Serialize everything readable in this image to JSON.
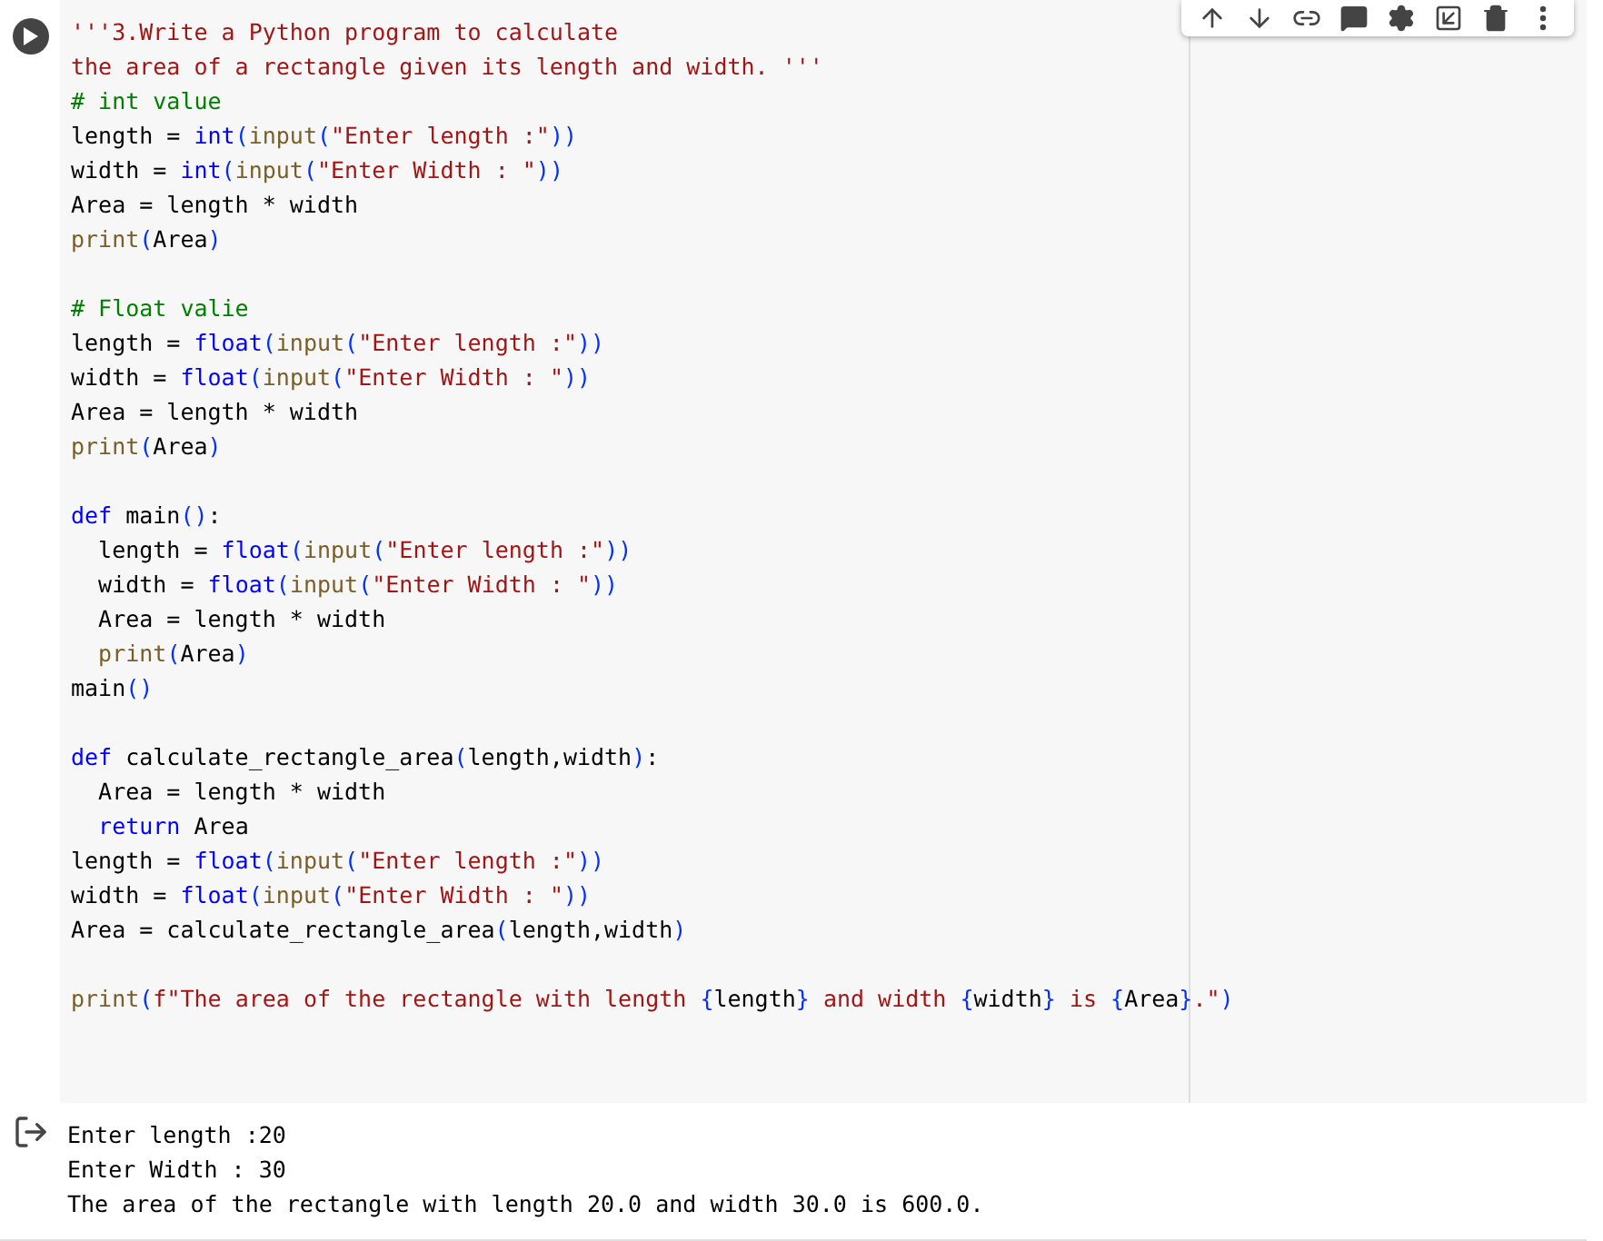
{
  "toolbar": {
    "buttons": [
      {
        "kind": "up"
      },
      {
        "kind": "down"
      },
      {
        "kind": "link"
      },
      {
        "kind": "comment"
      },
      {
        "kind": "settings"
      },
      {
        "kind": "mirror"
      },
      {
        "kind": "delete"
      },
      {
        "kind": "more"
      }
    ]
  },
  "code_blocks": [
    {
      "lines": [
        [
          {
            "kind": "str",
            "text": "'''3.Write a Python program to calculate"
          }
        ],
        [
          {
            "kind": "str",
            "text": "the area of a rectangle given its length and width. '''"
          }
        ],
        [
          {
            "kind": "comment",
            "text": "# int value"
          }
        ],
        [
          {
            "kind": "plain",
            "text": "length = "
          },
          {
            "kind": "kw",
            "text": "int"
          },
          {
            "kind": "paren",
            "text": "("
          },
          {
            "kind": "fn",
            "text": "input"
          },
          {
            "kind": "paren",
            "text": "("
          },
          {
            "kind": "str",
            "text": "\"Enter length :\""
          },
          {
            "kind": "paren",
            "text": "))"
          }
        ],
        [
          {
            "kind": "plain",
            "text": "width = "
          },
          {
            "kind": "kw",
            "text": "int"
          },
          {
            "kind": "paren",
            "text": "("
          },
          {
            "kind": "fn",
            "text": "input"
          },
          {
            "kind": "paren",
            "text": "("
          },
          {
            "kind": "str",
            "text": "\"Enter Width : \""
          },
          {
            "kind": "paren",
            "text": "))"
          }
        ],
        [
          {
            "kind": "plain",
            "text": "Area = length * width"
          }
        ],
        [
          {
            "kind": "fn",
            "text": "print"
          },
          {
            "kind": "paren",
            "text": "("
          },
          {
            "kind": "plain",
            "text": "Area"
          },
          {
            "kind": "paren",
            "text": ")"
          }
        ]
      ]
    },
    {
      "lines": [
        [
          {
            "kind": "comment",
            "text": "# Float valie"
          }
        ],
        [
          {
            "kind": "plain",
            "text": "length = "
          },
          {
            "kind": "kw",
            "text": "float"
          },
          {
            "kind": "paren",
            "text": "("
          },
          {
            "kind": "fn",
            "text": "input"
          },
          {
            "kind": "paren",
            "text": "("
          },
          {
            "kind": "str",
            "text": "\"Enter length :\""
          },
          {
            "kind": "paren",
            "text": "))"
          }
        ],
        [
          {
            "kind": "plain",
            "text": "width = "
          },
          {
            "kind": "kw",
            "text": "float"
          },
          {
            "kind": "paren",
            "text": "("
          },
          {
            "kind": "fn",
            "text": "input"
          },
          {
            "kind": "paren",
            "text": "("
          },
          {
            "kind": "str",
            "text": "\"Enter Width : \""
          },
          {
            "kind": "paren",
            "text": "))"
          }
        ],
        [
          {
            "kind": "plain",
            "text": "Area = length * width"
          }
        ],
        [
          {
            "kind": "fn",
            "text": "print"
          },
          {
            "kind": "paren",
            "text": "("
          },
          {
            "kind": "plain",
            "text": "Area"
          },
          {
            "kind": "paren",
            "text": ")"
          }
        ]
      ]
    },
    {
      "lines": [
        [
          {
            "kind": "kw",
            "text": "def"
          },
          {
            "kind": "plain",
            "text": " main"
          },
          {
            "kind": "paren",
            "text": "()"
          },
          {
            "kind": "plain",
            "text": ":"
          }
        ],
        [
          {
            "kind": "plain",
            "text": "  length = "
          },
          {
            "kind": "kw",
            "text": "float"
          },
          {
            "kind": "paren",
            "text": "("
          },
          {
            "kind": "fn",
            "text": "input"
          },
          {
            "kind": "paren",
            "text": "("
          },
          {
            "kind": "str",
            "text": "\"Enter length :\""
          },
          {
            "kind": "paren",
            "text": "))"
          }
        ],
        [
          {
            "kind": "plain",
            "text": "  width = "
          },
          {
            "kind": "kw",
            "text": "float"
          },
          {
            "kind": "paren",
            "text": "("
          },
          {
            "kind": "fn",
            "text": "input"
          },
          {
            "kind": "paren",
            "text": "("
          },
          {
            "kind": "str",
            "text": "\"Enter Width : \""
          },
          {
            "kind": "paren",
            "text": "))"
          }
        ],
        [
          {
            "kind": "plain",
            "text": "  Area = length * width"
          }
        ],
        [
          {
            "kind": "fn",
            "text": "  print"
          },
          {
            "kind": "paren",
            "text": "("
          },
          {
            "kind": "plain",
            "text": "Area"
          },
          {
            "kind": "paren",
            "text": ")"
          }
        ],
        [
          {
            "kind": "plain",
            "text": "main"
          },
          {
            "kind": "paren",
            "text": "()"
          }
        ]
      ]
    },
    {
      "lines": [
        [
          {
            "kind": "kw",
            "text": "def"
          },
          {
            "kind": "plain",
            "text": " calculate_rectangle_area"
          },
          {
            "kind": "paren",
            "text": "("
          },
          {
            "kind": "plain",
            "text": "length,width"
          },
          {
            "kind": "paren",
            "text": ")"
          },
          {
            "kind": "plain",
            "text": ":"
          }
        ],
        [
          {
            "kind": "plain",
            "text": "  Area = length * width"
          }
        ],
        [
          {
            "kind": "kw",
            "text": "  return"
          },
          {
            "kind": "plain",
            "text": " Area"
          }
        ],
        [
          {
            "kind": "plain",
            "text": "length = "
          },
          {
            "kind": "kw",
            "text": "float"
          },
          {
            "kind": "paren",
            "text": "("
          },
          {
            "kind": "fn",
            "text": "input"
          },
          {
            "kind": "paren",
            "text": "("
          },
          {
            "kind": "str",
            "text": "\"Enter length :\""
          },
          {
            "kind": "paren",
            "text": "))"
          }
        ],
        [
          {
            "kind": "plain",
            "text": "width = "
          },
          {
            "kind": "kw",
            "text": "float"
          },
          {
            "kind": "paren",
            "text": "("
          },
          {
            "kind": "fn",
            "text": "input"
          },
          {
            "kind": "paren",
            "text": "("
          },
          {
            "kind": "str",
            "text": "\"Enter Width : \""
          },
          {
            "kind": "paren",
            "text": "))"
          }
        ],
        [
          {
            "kind": "plain",
            "text": "Area = calculate_rectangle_area"
          },
          {
            "kind": "paren",
            "text": "("
          },
          {
            "kind": "plain",
            "text": "length,width"
          },
          {
            "kind": "paren",
            "text": ")"
          }
        ]
      ]
    },
    {
      "lines": [
        [
          {
            "kind": "fn",
            "text": "print"
          },
          {
            "kind": "paren",
            "text": "("
          },
          {
            "kind": "str",
            "text": "f\"The area of the rectangle with length "
          },
          {
            "kind": "paren",
            "text": "{"
          },
          {
            "kind": "plain",
            "text": "length"
          },
          {
            "kind": "paren",
            "text": "}"
          },
          {
            "kind": "str",
            "text": " and width "
          },
          {
            "kind": "paren",
            "text": "{"
          },
          {
            "kind": "plain",
            "text": "width"
          },
          {
            "kind": "paren",
            "text": "}"
          },
          {
            "kind": "str",
            "text": " is "
          },
          {
            "kind": "paren",
            "text": "{"
          },
          {
            "kind": "plain",
            "text": "Area"
          },
          {
            "kind": "paren",
            "text": "}"
          },
          {
            "kind": "str",
            "text": ".\""
          },
          {
            "kind": "paren",
            "text": ")"
          }
        ]
      ]
    }
  ],
  "output": [
    "Enter length :20",
    "Enter Width : 30",
    "The area of the rectangle with length 20.0 and width 30.0 is 600.0."
  ]
}
